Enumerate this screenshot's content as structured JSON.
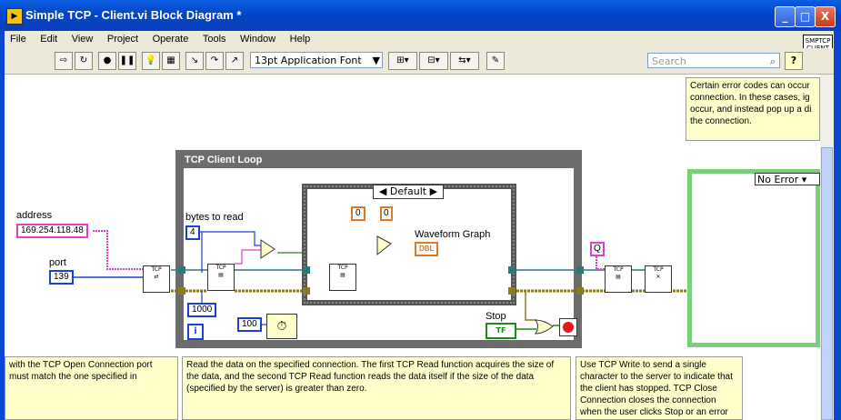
{
  "window": {
    "title": "Simple TCP - Client.vi Block Diagram *",
    "buttons": {
      "minimize": "_",
      "maximize": "□",
      "close": "X"
    }
  },
  "menu": [
    "File",
    "Edit",
    "View",
    "Project",
    "Operate",
    "Tools",
    "Window",
    "Help"
  ],
  "toolbar": {
    "font": "13pt Application Font",
    "search_placeholder": "Search",
    "help": "?"
  },
  "vi_icon": {
    "text": "SMPTCP CLIENT"
  },
  "diagram": {
    "address_label": "address",
    "address_value": "169.254.118.48",
    "port_label": "port",
    "port_value": "139",
    "loop_title": "TCP Client Loop",
    "bytes_label": "bytes to read",
    "bytes_value": "4",
    "timeout_value": "1000",
    "wait_value": "100",
    "iteration": "i",
    "case_selector": "Default",
    "zero_const": "0",
    "zero_small": "0",
    "graph_label": "Waveform Graph",
    "graph_type": "DBL",
    "q_const": "Q",
    "stop_label": "Stop",
    "stop_bool": "TF",
    "error_selector": "No Error",
    "case_arrows": {
      "left": "◀",
      "right": "▶"
    }
  },
  "comments": {
    "top_right": "Certain error codes can occur connection. In these cases, ig occur, and instead pop up a di the connection.",
    "left": "with the TCP Open Connection port must match the one specified in",
    "middle": "Read the data on the specified connection. The first TCP Read function acquires the size of the data, and the second TCP Read function reads the data itself if the size of the data (specified by the server) is greater than zero.",
    "right": "Use TCP Write to send a single character to the server to indicate that the client has stopped. TCP Close Connection closes the connection when the user clicks Stop or an error"
  },
  "colors": {
    "titlebar": "#0245c8",
    "loop_frame": "#6c6c6c",
    "wire_int": "#1e3fd6",
    "wire_string": "#e040c8",
    "wire_dbl": "#e07a20",
    "wire_bool": "#1a8a1a",
    "error_case": "#7ad07a"
  }
}
